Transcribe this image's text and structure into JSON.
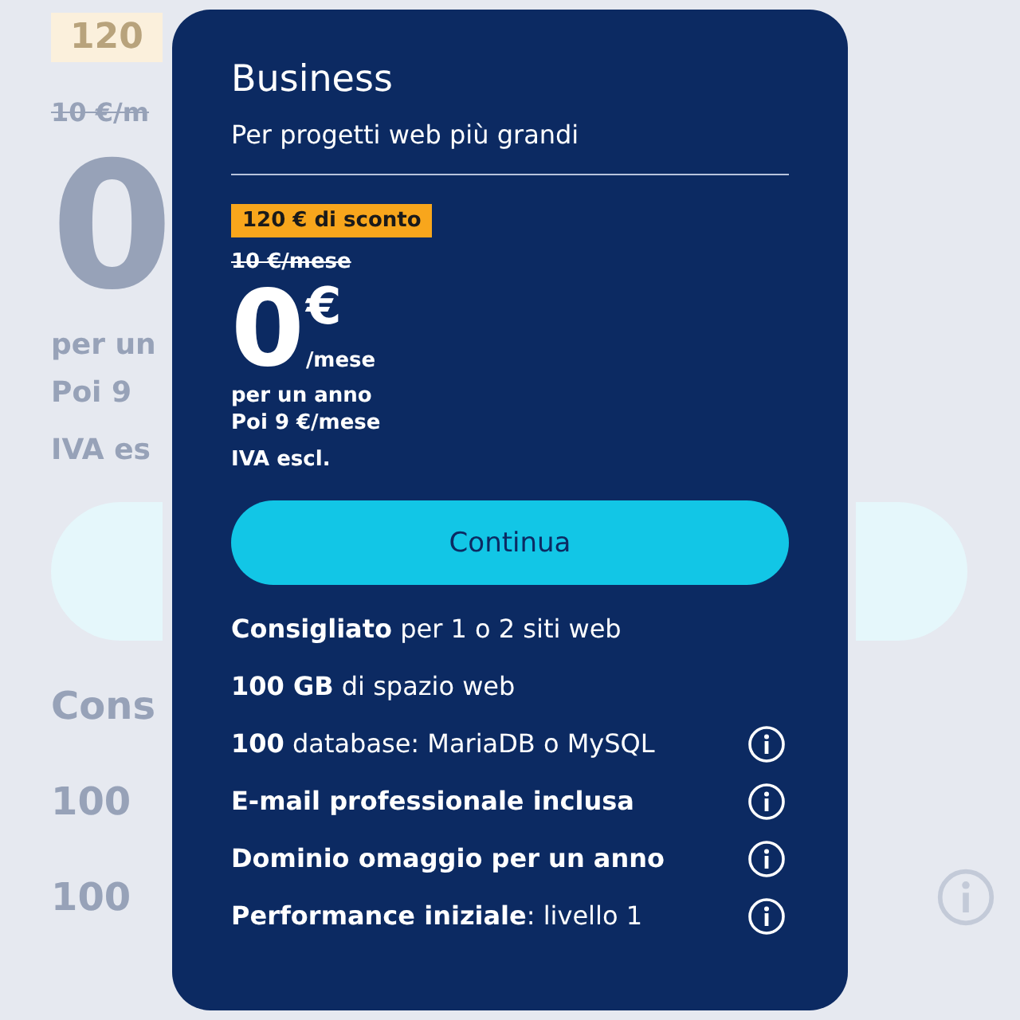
{
  "background": {
    "badge": "120",
    "old_price": "10 €/m",
    "price": "0",
    "lines": [
      "per un",
      "Poi 9"
    ],
    "vat": "IVA es",
    "features": [
      {
        "text": "Cons",
        "info": false
      },
      {
        "text": "100",
        "info": false
      },
      {
        "text": "100",
        "info": true
      }
    ]
  },
  "card": {
    "title": "Business",
    "subtitle": "Per progetti web più grandi",
    "badge": "120 € di sconto",
    "old_price": "10 €/mese",
    "price": "0",
    "currency": "€",
    "period": "/mese",
    "lines": [
      "per un anno",
      "Poi 9 €/mese"
    ],
    "vat": "IVA escl.",
    "button": "Continua",
    "features": [
      {
        "text": "**Consigliato** per 1 o 2 siti web",
        "info": false
      },
      {
        "text": "**100 GB** di spazio web",
        "info": false
      },
      {
        "text": "**100** database: MariaDB o MySQL",
        "info": true
      },
      {
        "text": "**E-mail professionale inclusa**",
        "info": true
      },
      {
        "text": "**Dominio omaggio per un anno**",
        "info": true
      },
      {
        "text": "**Performance iniziale**: livello 1",
        "info": true
      }
    ]
  }
}
